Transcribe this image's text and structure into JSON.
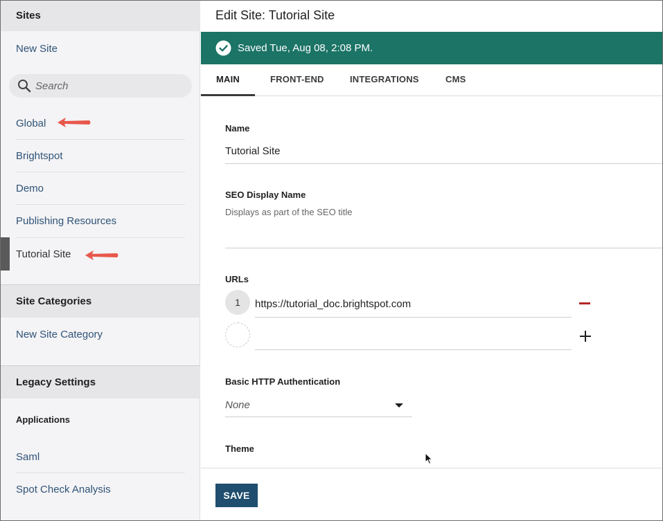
{
  "sidebar": {
    "sites_header": "Sites",
    "new_site": "New Site",
    "search_placeholder": "Search",
    "sites": [
      {
        "label": "Global"
      },
      {
        "label": "Brightspot"
      },
      {
        "label": "Demo"
      },
      {
        "label": "Publishing Resources"
      },
      {
        "label": "Tutorial Site"
      }
    ],
    "categories_header": "Site Categories",
    "new_category": "New Site Category",
    "legacy_header": "Legacy Settings",
    "applications_header": "Applications",
    "applications": [
      {
        "label": "Saml"
      },
      {
        "label": "Spot Check Analysis"
      }
    ]
  },
  "main": {
    "title": "Edit Site: Tutorial Site",
    "banner": "Saved Tue, Aug 08, 2:08 PM.",
    "tabs": [
      {
        "label": "MAIN"
      },
      {
        "label": "FRONT-END"
      },
      {
        "label": "INTEGRATIONS"
      },
      {
        "label": "CMS"
      }
    ],
    "form": {
      "name_label": "Name",
      "name_value": "Tutorial Site",
      "seo_label": "SEO Display Name",
      "seo_hint": "Displays as part of the SEO title",
      "urls_label": "URLs",
      "urls": [
        {
          "index": "1",
          "value": "https://tutorial_doc.brightspot.com"
        }
      ],
      "auth_label": "Basic HTTP Authentication",
      "auth_value": "None",
      "theme_label": "Theme"
    },
    "save_label": "SAVE"
  },
  "colors": {
    "banner": "#1b7466",
    "save_button": "#1f4e6e",
    "link": "#2f5478",
    "annotation_arrow": "#e8574b",
    "remove": "#b52626"
  }
}
